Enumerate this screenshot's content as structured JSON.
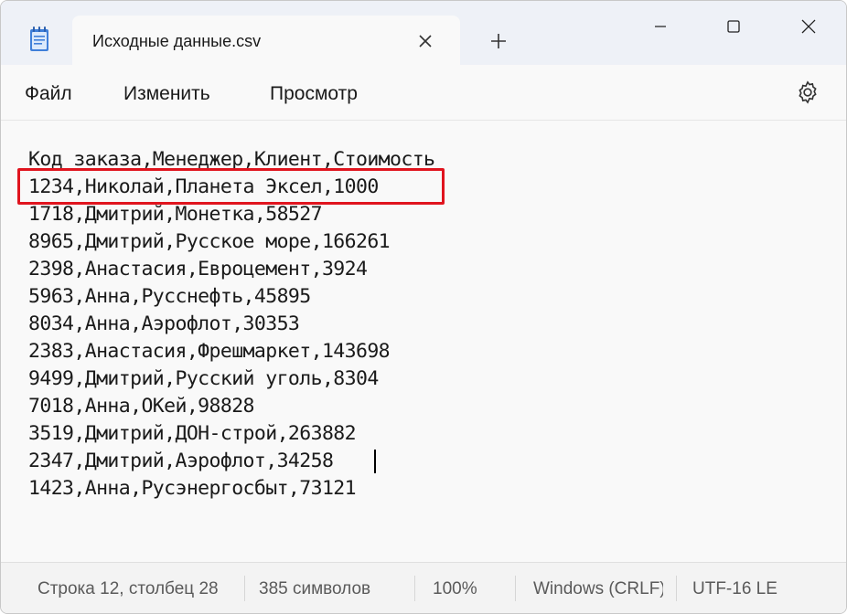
{
  "tab": {
    "title": "Исходные данные.csv"
  },
  "menu": {
    "file": "Файл",
    "edit": "Изменить",
    "view": "Просмотр"
  },
  "editor": {
    "lines": [
      "Код заказа,Менеджер,Клиент,Стоимость",
      "1234,Николай,Планета Эксел,1000",
      "1718,Дмитрий,Монетка,58527",
      "8965,Дмитрий,Русское море,166261",
      "2398,Анастасия,Евроцемент,3924",
      "5963,Анна,Русснефть,45895",
      "8034,Анна,Аэрофлот,30353",
      "2383,Анастасия,Фрешмаркет,143698",
      "9499,Дмитрий,Русский уголь,8304",
      "7018,Анна,ОКей,98828",
      "3519,Дмитрий,ДОН-строй,263882",
      "2347,Дмитрий,Аэрофлот,34258",
      "1423,Анна,Русэнергосбыт,73121"
    ],
    "highlighted_line": 2,
    "highlight_color": "#e0141e"
  },
  "status": {
    "position": "Строка 12, столбец 28",
    "chars": "385 символов",
    "zoom": "100%",
    "line_ending": "Windows (CRLF)",
    "encoding": "UTF-16 LE"
  },
  "icons": {
    "app": "notepad-icon",
    "close_tab": "close-icon",
    "new_tab": "plus-icon",
    "settings": "gear-icon"
  }
}
